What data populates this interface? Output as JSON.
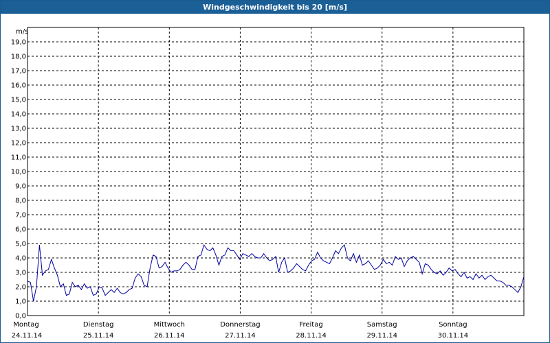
{
  "title": "Windgeschwindigkeit bis 20 [m/s]",
  "colors": {
    "title_bar": "#1b5f97",
    "series": "#0000a0",
    "grid": "#000000"
  },
  "chart_data": {
    "type": "line",
    "title": "Windgeschwindigkeit bis 20 [m/s]",
    "ylabel": "m/s",
    "ylim": [
      0,
      20
    ],
    "y_ticks": [
      "0,0",
      "1,0",
      "2,0",
      "3,0",
      "4,0",
      "5,0",
      "6,0",
      "7,0",
      "8,0",
      "9,0",
      "10,0",
      "11,0",
      "12,0",
      "13,0",
      "14,0",
      "15,0",
      "16,0",
      "17,0",
      "18,0",
      "19,0"
    ],
    "xlim": [
      0,
      7
    ],
    "x_unit": "days from 24.11.14 00:00",
    "x_ticks": [
      {
        "day": "Montag",
        "date": "24.11.14"
      },
      {
        "day": "Dienstag",
        "date": "25.11.14"
      },
      {
        "day": "Mittwoch",
        "date": "26.11.14"
      },
      {
        "day": "Donnerstag",
        "date": "27.11.14"
      },
      {
        "day": "Freitag",
        "date": "28.11.14"
      },
      {
        "day": "Samstag",
        "date": "29.11.14"
      },
      {
        "day": "Sonntag",
        "date": "30.11.14"
      }
    ],
    "grid": true,
    "series": [
      {
        "values": [
          2.4,
          2.3,
          1.0,
          2.0,
          4.9,
          2.8,
          3.1,
          3.2,
          3.9,
          3.3,
          2.8,
          2.0,
          2.2,
          1.4,
          1.5,
          2.3,
          2.0,
          2.1,
          1.8,
          2.2,
          1.9,
          2.0,
          1.4,
          1.5,
          2.0,
          1.9,
          1.4,
          1.6,
          1.8,
          1.6,
          1.9,
          1.6,
          1.5,
          1.6,
          1.8,
          1.9,
          2.6,
          2.9,
          2.7,
          2.1,
          2.0,
          3.3,
          4.2,
          4.1,
          3.3,
          3.4,
          3.7,
          3.3,
          3.0,
          3.1,
          3.1,
          3.2,
          3.5,
          3.7,
          3.5,
          3.2,
          3.2,
          4.1,
          4.2,
          4.9,
          4.6,
          4.5,
          4.7,
          4.2,
          3.5,
          4.1,
          4.2,
          4.7,
          4.5,
          4.5,
          4.2,
          3.9,
          4.3,
          4.2,
          4.1,
          4.3,
          4.1,
          4.0,
          4.0,
          4.3,
          4.0,
          3.8,
          3.9,
          4.1,
          3.0,
          3.7,
          4.0,
          3.0,
          3.1,
          3.3,
          3.6,
          3.4,
          3.2,
          3.1,
          3.5,
          3.8,
          3.9,
          4.4,
          4.0,
          3.8,
          3.7,
          3.6,
          4.0,
          4.5,
          4.3,
          4.7,
          4.9,
          4.0,
          3.8,
          4.3,
          3.7,
          4.2,
          3.5,
          3.6,
          3.8,
          3.5,
          3.2,
          3.3,
          3.5,
          3.9,
          3.6,
          3.7,
          3.5,
          4.1,
          3.9,
          4.0,
          3.4,
          3.8,
          4.0,
          4.1,
          3.9,
          3.7,
          2.9,
          3.6,
          3.5,
          3.2,
          3.0,
          2.9,
          3.1,
          2.8,
          3.0,
          3.3,
          3.1,
          3.2,
          2.9,
          2.7,
          3.0,
          2.6,
          2.7,
          2.5,
          2.9,
          2.6,
          2.8,
          2.5,
          2.7,
          2.8,
          2.6,
          2.4,
          2.4,
          2.3,
          2.1,
          2.1,
          2.0,
          1.8,
          1.6,
          2.0,
          2.7
        ]
      }
    ]
  }
}
